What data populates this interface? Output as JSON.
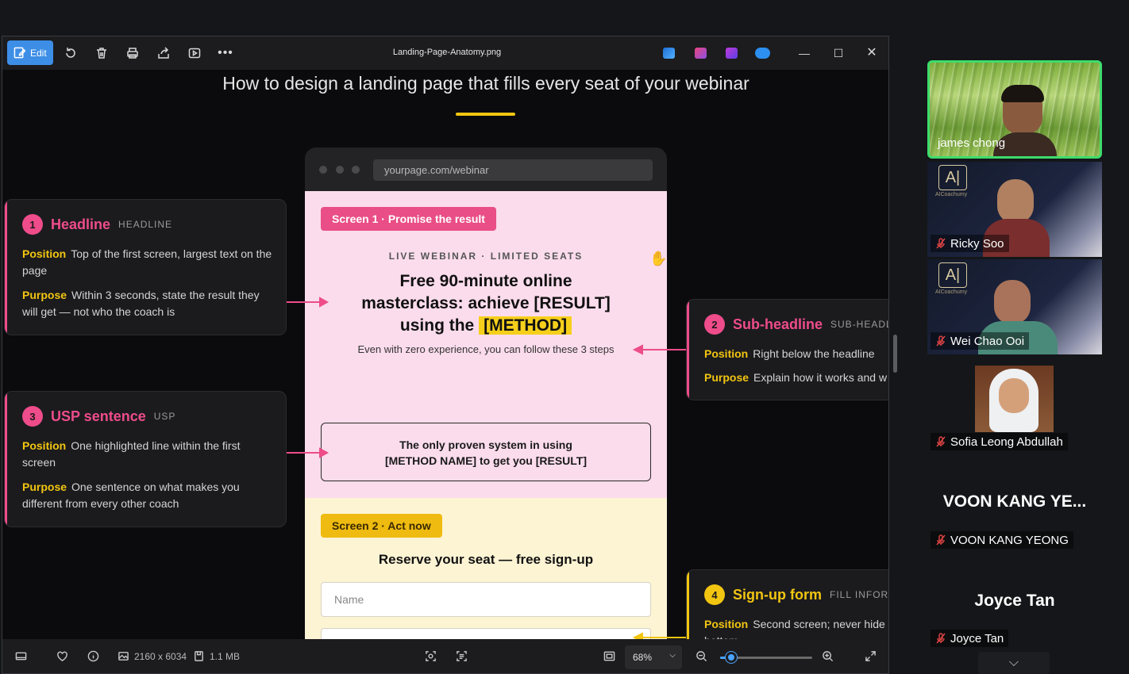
{
  "viewer": {
    "file_name": "Landing-Page-Anatomy.png",
    "edit_label": "Edit",
    "image_title": "How to design a landing page that fills every seat of your webinar",
    "status": {
      "dimensions": "2160 x 6034",
      "file_size": "1.1 MB",
      "zoom": "68%",
      "zoom_fraction": 0.12
    }
  },
  "mockup": {
    "url": "yourpage.com/webinar",
    "screen1": {
      "pill": "Screen 1 · Promise the result",
      "eyebrow": "LIVE WEBINAR · LIMITED SEATS",
      "headline_line1": "Free 90-minute online",
      "headline_line2": "masterclass: achieve [RESULT]",
      "headline_using": "using the",
      "headline_method": "[METHOD]",
      "subline": "Even with zero experience, you can follow these 3 steps",
      "usp_line1": "The only proven system in using",
      "usp_line2": "[METHOD NAME] to get you [RESULT]"
    },
    "screen2": {
      "pill": "Screen 2 · Act now",
      "heading": "Reserve your seat — free sign-up",
      "name_placeholder": "Name"
    }
  },
  "cards": [
    {
      "num": "1",
      "title": "Headline",
      "tag": "HEADLINE",
      "position_label": "Position",
      "position_text": "Top of the first screen, largest text on the page",
      "purpose_label": "Purpose",
      "purpose_text": "Within 3 seconds, state the result they will get — not who the coach is"
    },
    {
      "num": "2",
      "title": "Sub-headline",
      "tag": "SUB-HEADLINE",
      "position_label": "Position",
      "position_text": "Right below the headline",
      "purpose_label": "Purpose",
      "purpose_text": "Explain how it works and w"
    },
    {
      "num": "3",
      "title": "USP sentence",
      "tag": "USP",
      "position_label": "Position",
      "position_text": "One highlighted line within the first screen",
      "purpose_label": "Purpose",
      "purpose_text": "One sentence on what makes you different from every other coach"
    },
    {
      "num": "4",
      "title": "Sign-up form",
      "tag": "FILL INFOR",
      "position_label": "Position",
      "position_text": "Second screen; never hide",
      "position_text2": "bottom"
    }
  ],
  "participants": [
    {
      "name": "james chong",
      "muted": false,
      "active": true
    },
    {
      "name": "Ricky Soo",
      "muted": true,
      "logo_text": "AICoachumy"
    },
    {
      "name": "Wei Chao Ooi",
      "muted": true,
      "logo_text": "AICoachumy"
    },
    {
      "name": "Sofia Leong Abdullah",
      "muted": true
    },
    {
      "name": "VOON KANG YEONG",
      "muted": true,
      "big_name": "VOON KANG YE..."
    },
    {
      "name": "Joyce Tan",
      "muted": true,
      "big_name": "Joyce Tan"
    }
  ],
  "colors": {
    "accent_pink": "#ee4c8a",
    "accent_yellow": "#f2c511",
    "edit_blue": "#3d8ee6",
    "speaker_green": "#3ddc6b"
  }
}
